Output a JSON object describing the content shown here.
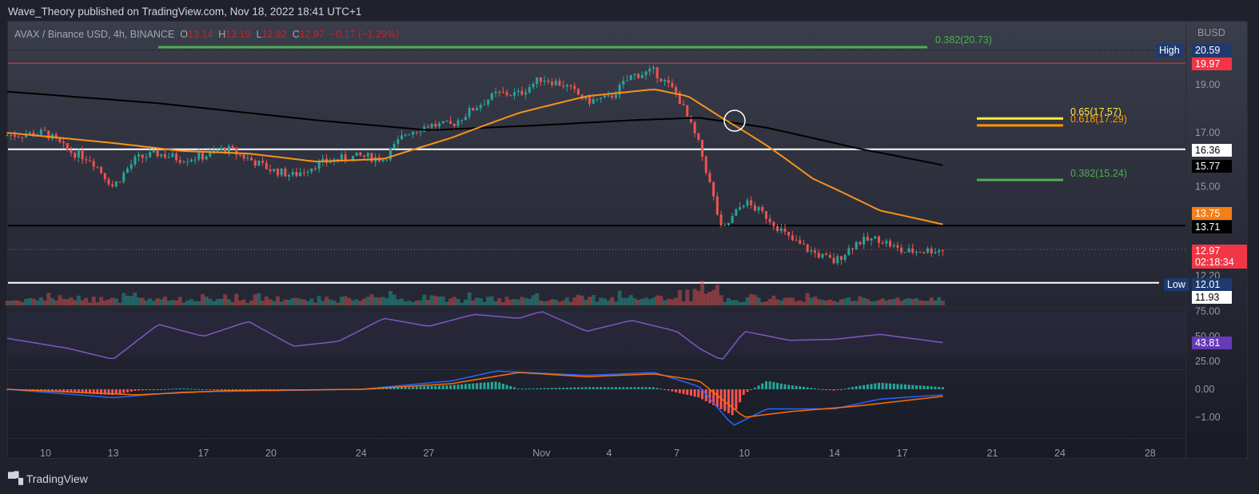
{
  "header": {
    "published": "Wave_Theory published on TradingView.com, Nov 18, 2022 18:41 UTC+1"
  },
  "legend": {
    "symbol": "AVAX / Binance USD, 4h, BINANCE",
    "o_label": "O",
    "o": "13.14",
    "h_label": "H",
    "h": "13.19",
    "l_label": "L",
    "l": "12.92",
    "c_label": "C",
    "c": "12.97",
    "change": "−0.17 (−1.29%)"
  },
  "price_axis": {
    "currency": "BUSD",
    "ticks": [
      "19.00",
      "17.00",
      "15.00",
      "12.20"
    ]
  },
  "tags": {
    "high_label": "High",
    "high": "20.59",
    "red_line": "19.97",
    "white_line": "16.36",
    "ma200": "15.77",
    "ma50": "13.75",
    "black_line": "13.71",
    "last": "12.97",
    "countdown": "02:18:34",
    "low_label": "Low",
    "low": "12.01",
    "white_low": "11.93"
  },
  "fib": {
    "f1": "0.382(20.73)",
    "f2": "0.65(17.57)",
    "f3": "0.618(17.29)",
    "f4": "0.382(15.24)"
  },
  "rsi_axis": {
    "ticks": [
      "75.00",
      "50.00",
      "25.00"
    ],
    "value": "43.81"
  },
  "macd_axis": {
    "ticks": [
      "0.00",
      "−1.00"
    ]
  },
  "time_axis": [
    "10",
    "13",
    "17",
    "20",
    "24",
    "27",
    "Nov",
    "4",
    "7",
    "10",
    "14",
    "17",
    "21",
    "24",
    "28"
  ],
  "brand": "TradingView",
  "colors": {
    "up": "#26a69a",
    "down": "#ef5350",
    "ma50": "#f7931a",
    "ma200": "#000000",
    "rsi": "#7e57c2",
    "macd": "#2962ff",
    "signal": "#ff6d00"
  },
  "chart_data": {
    "type": "candlestick",
    "symbol": "AVAX/BUSD",
    "interval": "4h",
    "scale": "log",
    "x_unit": "days since Oct 10 2022",
    "close": [
      [
        -1.7,
        16.9
      ],
      [
        0,
        17.0
      ],
      [
        1,
        16.3
      ],
      [
        2,
        16.0
      ],
      [
        3,
        15.0
      ],
      [
        4,
        16.0
      ],
      [
        5,
        16.2
      ],
      [
        6,
        16.0
      ],
      [
        7,
        16.1
      ],
      [
        8,
        16.4
      ],
      [
        9,
        16.0
      ],
      [
        10,
        15.6
      ],
      [
        11,
        15.4
      ],
      [
        12,
        15.8
      ],
      [
        13,
        16.0
      ],
      [
        14,
        16.1
      ],
      [
        15,
        16.0
      ],
      [
        16,
        17.0
      ],
      [
        17,
        17.3
      ],
      [
        18,
        17.3
      ],
      [
        19,
        18.0
      ],
      [
        20,
        18.6
      ],
      [
        21,
        18.6
      ],
      [
        22,
        19.3
      ],
      [
        23,
        19.0
      ],
      [
        24,
        18.3
      ],
      [
        25,
        18.4
      ],
      [
        26,
        19.4
      ],
      [
        27,
        19.6
      ],
      [
        28,
        18.6
      ],
      [
        29,
        16.5
      ],
      [
        30,
        13.5
      ],
      [
        31,
        14.5
      ],
      [
        32,
        14.0
      ],
      [
        33,
        13.3
      ],
      [
        34,
        12.9
      ],
      [
        35,
        12.6
      ],
      [
        36,
        13.2
      ],
      [
        37,
        13.3
      ],
      [
        38,
        12.9
      ],
      [
        39.8,
        12.97
      ]
    ],
    "ma50": [
      [
        -1.7,
        17.0
      ],
      [
        3,
        16.6
      ],
      [
        6,
        16.3
      ],
      [
        9,
        16.2
      ],
      [
        12,
        15.9
      ],
      [
        15,
        16.0
      ],
      [
        18,
        16.8
      ],
      [
        21,
        17.8
      ],
      [
        24,
        18.5
      ],
      [
        27,
        18.8
      ],
      [
        28.5,
        18.5
      ],
      [
        30,
        17.6
      ],
      [
        32,
        16.5
      ],
      [
        34,
        15.3
      ],
      [
        37,
        14.2
      ],
      [
        39.8,
        13.75
      ]
    ],
    "ma200": [
      [
        -1.7,
        18.7
      ],
      [
        5,
        18.2
      ],
      [
        12,
        17.5
      ],
      [
        17,
        17.1
      ],
      [
        22,
        17.3
      ],
      [
        26,
        17.5
      ],
      [
        29,
        17.6
      ],
      [
        32,
        17.2
      ],
      [
        36,
        16.4
      ],
      [
        39.8,
        15.77
      ]
    ],
    "rsi": [
      [
        -1.7,
        48
      ],
      [
        1,
        38
      ],
      [
        3,
        27
      ],
      [
        5,
        62
      ],
      [
        7,
        50
      ],
      [
        9,
        65
      ],
      [
        11,
        40
      ],
      [
        13,
        45
      ],
      [
        15,
        68
      ],
      [
        17,
        60
      ],
      [
        19,
        72
      ],
      [
        21,
        68
      ],
      [
        22,
        75
      ],
      [
        24,
        55
      ],
      [
        26,
        66
      ],
      [
        28,
        55
      ],
      [
        29,
        38
      ],
      [
        30,
        26
      ],
      [
        31,
        55
      ],
      [
        33,
        46
      ],
      [
        35,
        47
      ],
      [
        37,
        52
      ],
      [
        39.8,
        43.81
      ]
    ],
    "macd": [
      [
        -1.7,
        0
      ],
      [
        3,
        -0.3
      ],
      [
        6,
        -0.1
      ],
      [
        10,
        -0.05
      ],
      [
        14,
        0
      ],
      [
        18,
        0.3
      ],
      [
        20,
        0.65
      ],
      [
        24,
        0.5
      ],
      [
        27,
        0.6
      ],
      [
        29,
        0.1
      ],
      [
        30.5,
        -1.3
      ],
      [
        32,
        -0.7
      ],
      [
        35,
        -0.7
      ],
      [
        37,
        -0.35
      ],
      [
        39.8,
        -0.2
      ]
    ],
    "signal": [
      [
        -1.7,
        0
      ],
      [
        4,
        -0.2
      ],
      [
        8,
        -0.05
      ],
      [
        14,
        0
      ],
      [
        18,
        0.2
      ],
      [
        21,
        0.6
      ],
      [
        24,
        0.45
      ],
      [
        27,
        0.55
      ],
      [
        29,
        0.3
      ],
      [
        31,
        -1.0
      ],
      [
        33,
        -0.8
      ],
      [
        36,
        -0.6
      ],
      [
        39.8,
        -0.25
      ]
    ],
    "levels": {
      "fib_0382_high": 20.73,
      "fib_065": 17.57,
      "fib_0618": 17.29,
      "fib_0382_low": 15.24,
      "resistance": 16.36,
      "support": 13.71,
      "low_line": 12.01,
      "high": 20.59,
      "red": 19.97
    }
  }
}
